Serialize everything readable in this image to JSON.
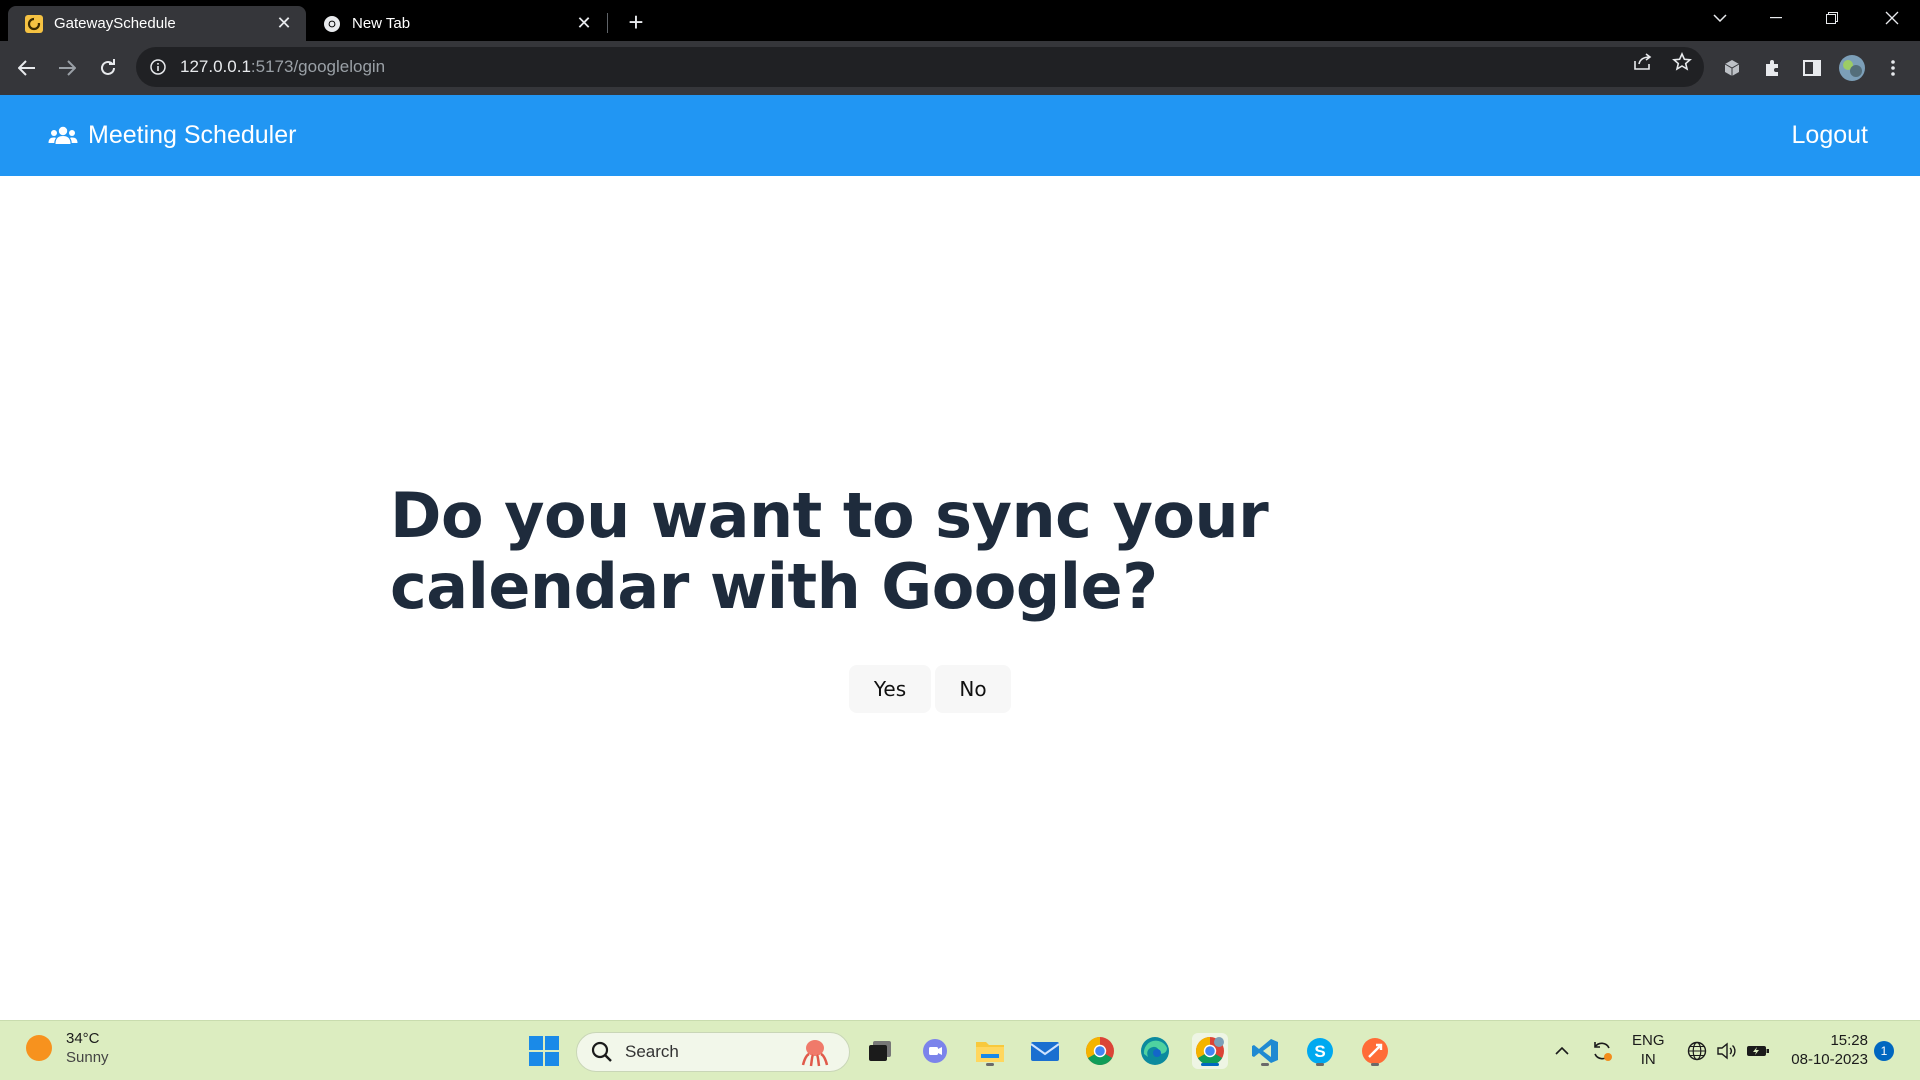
{
  "browser": {
    "tabs": [
      {
        "title": "GatewaySchedule",
        "favicon": "gateway-logo-icon",
        "active": true
      },
      {
        "title": "New Tab",
        "favicon": "chrome-icon",
        "active": false
      }
    ],
    "new_tab_icon": "plus-icon",
    "url_host": "127.0.0.1",
    "url_path": ":5173/googlelogin"
  },
  "navbar": {
    "brand": "Meeting Scheduler",
    "brand_icon": "users-icon",
    "logout": "Logout",
    "color": "#2196f3"
  },
  "main": {
    "question": "Do you want to sync your calendar with Google?",
    "yes_label": "Yes",
    "no_label": "No",
    "text_color": "#1e2b3c"
  },
  "taskbar": {
    "weather": {
      "temp": "34°C",
      "condition": "Sunny"
    },
    "search_placeholder": "Search",
    "lang_line1": "ENG",
    "lang_line2": "IN",
    "time": "15:28",
    "date": "08-10-2023",
    "notifications": "1"
  }
}
